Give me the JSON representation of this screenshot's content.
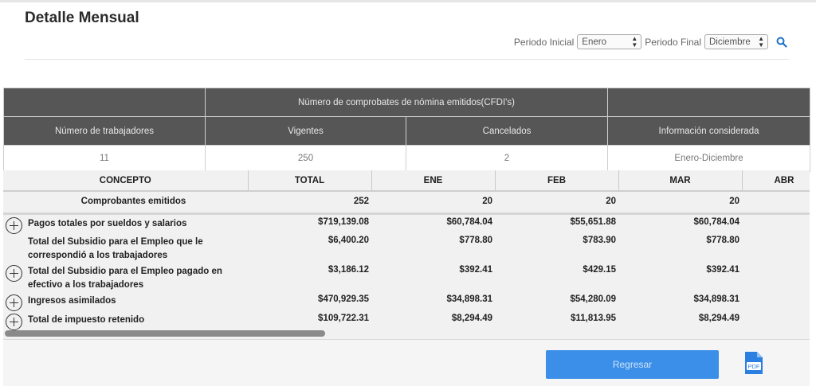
{
  "page": {
    "title": "Detalle Mensual"
  },
  "filters": {
    "start_label": "Periodo Inicial",
    "start_value": "Enero",
    "end_label": "Periodo Final",
    "end_value": "Diciembre",
    "search_icon": "search-icon"
  },
  "summary": {
    "group_header": "Número de comprobates de nómina emitidos(CFDI's)",
    "headers": [
      "Número de trabajadores",
      "Vigentes",
      "Cancelados",
      "Información considerada"
    ],
    "values": [
      "11",
      "250",
      "2",
      "Enero-Diciembre"
    ]
  },
  "grid": {
    "columns": [
      "CONCEPTO",
      "TOTAL",
      "ENE",
      "FEB",
      "MAR",
      "ABR"
    ],
    "summary_row": {
      "concept": "Comprobantes emitidos",
      "values": [
        "252",
        "20",
        "20",
        "20"
      ]
    },
    "rows": [
      {
        "concept": "Pagos totales por sueldos y salarios",
        "expandable": true,
        "values": [
          "$719,139.08",
          "$60,784.04",
          "$55,651.88",
          "$60,784.04"
        ]
      },
      {
        "concept": "Total del Subsidio para el Empleo que le correspondió a los trabajadores",
        "expandable": false,
        "values": [
          "$6,400.20",
          "$778.80",
          "$783.90",
          "$778.80"
        ]
      },
      {
        "concept": "Total del Subsidio para el Empleo pagado en efectivo a los trabajadores",
        "expandable": true,
        "values": [
          "$3,186.12",
          "$392.41",
          "$429.15",
          "$392.41"
        ]
      },
      {
        "concept": "Ingresos asimilados",
        "expandable": true,
        "values": [
          "$470,929.35",
          "$34,898.31",
          "$54,280.09",
          "$34,898.31"
        ]
      },
      {
        "concept": "Total de impuesto retenido",
        "expandable": true,
        "values": [
          "$109,722.31",
          "$8,294.49",
          "$11,813.95",
          "$8,294.49"
        ]
      }
    ]
  },
  "footer": {
    "back_label": "Regresar",
    "pdf_label": "PDF"
  },
  "colors": {
    "header_bg": "#565656",
    "button_bg": "#3b8fe9",
    "search_icon": "#1a73c8"
  }
}
